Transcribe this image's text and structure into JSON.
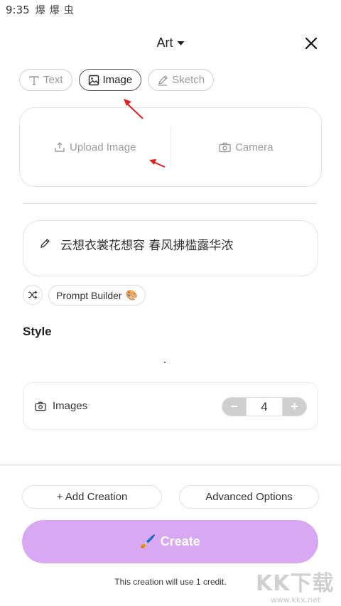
{
  "status_bar": {
    "time": "9:35",
    "icons": [
      "爆",
      "爆",
      "虫"
    ]
  },
  "header": {
    "title": "Art",
    "close_icon": "close-icon"
  },
  "mode_tabs": [
    {
      "label": "Text",
      "icon": "text-icon",
      "active": false
    },
    {
      "label": "Image",
      "icon": "image-icon",
      "active": true
    },
    {
      "label": "Sketch",
      "icon": "pencil-icon",
      "active": false
    }
  ],
  "upload": {
    "upload_label": "Upload Image",
    "camera_label": "Camera"
  },
  "prompt": {
    "text": "云想衣裳花想容 春风拂槛露华浓"
  },
  "prompt_builder": {
    "label": "Prompt Builder",
    "emoji": "🎨"
  },
  "style": {
    "heading": "Style"
  },
  "images": {
    "label": "Images",
    "count": "4",
    "decrement": "−",
    "increment": "+"
  },
  "actions": {
    "add_creation": "+ Add Creation",
    "advanced_options": "Advanced Options"
  },
  "create": {
    "label": "Create",
    "emoji": "🖌️",
    "color": "#d9a8f2"
  },
  "credit_note": "This creation will use 1 credit.",
  "watermark": {
    "main": "KK下载",
    "sub": "www.kkx.net"
  }
}
